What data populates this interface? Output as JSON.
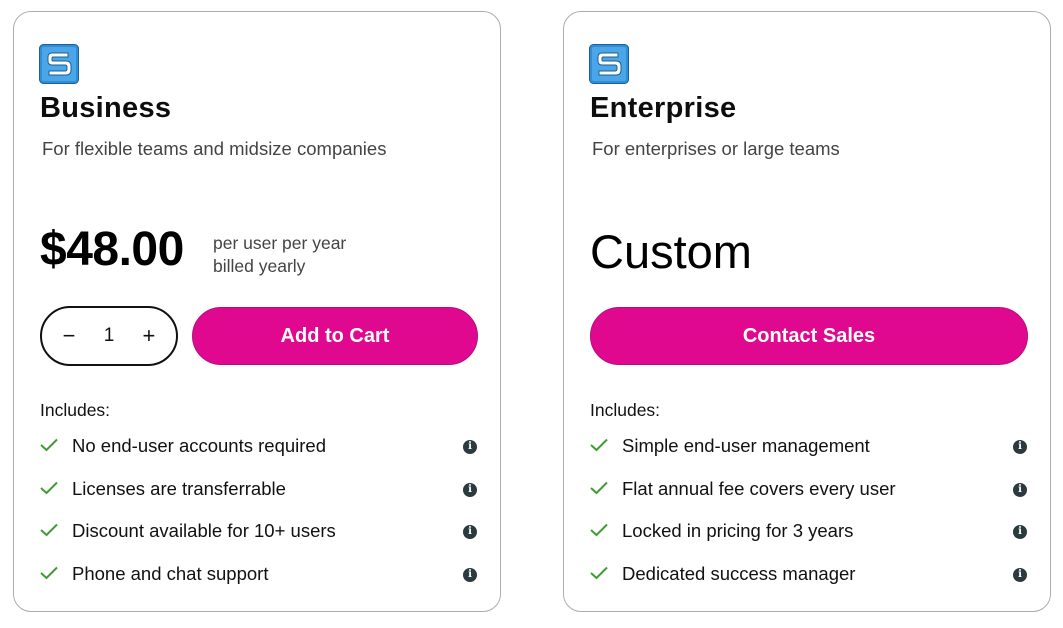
{
  "plans": [
    {
      "name": "Business",
      "description": "For flexible teams and midsize companies",
      "price": "$48.00",
      "price_note_line1": "per user per year",
      "price_note_line2": "billed yearly",
      "quantity": "1",
      "decrement": "−",
      "increment": "+",
      "cta": "Add to Cart",
      "includes_label": "Includes:",
      "features": [
        "No end-user accounts required",
        "Licenses are transferrable",
        "Discount available for 10+ users",
        "Phone and chat support"
      ]
    },
    {
      "name": "Enterprise",
      "description": "For enterprises or large teams",
      "price": "Custom",
      "cta": "Contact Sales",
      "includes_label": "Includes:",
      "features": [
        "Simple end-user management",
        "Flat annual fee covers every user",
        "Locked in pricing for 3 years",
        "Dedicated success manager"
      ]
    }
  ],
  "icons": {
    "logo": "snagit-s-logo",
    "check": "check-icon",
    "info": "info-icon"
  },
  "colors": {
    "cta": "#e0088f",
    "check": "#3f9c35",
    "logo": "#2f8fd6"
  }
}
